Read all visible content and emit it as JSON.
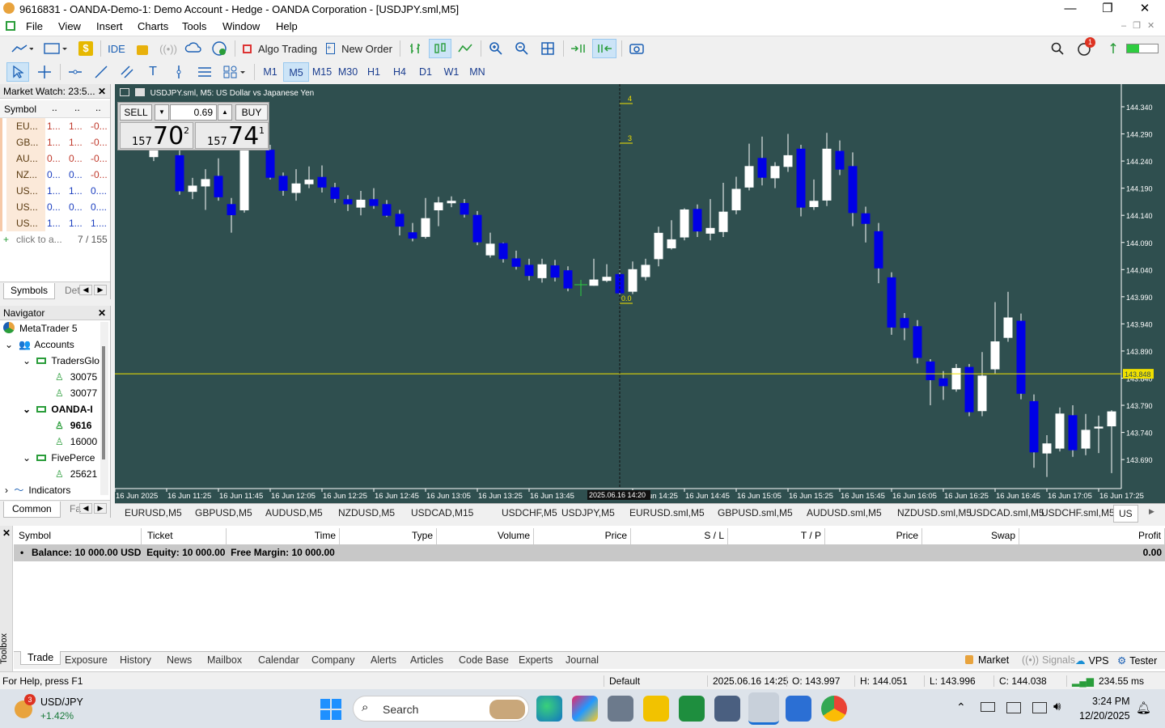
{
  "window": {
    "title": "9616831 - OANDA-Demo-1: Demo Account - Hedge - OANDA Corporation - [USDJPY.sml,M5]"
  },
  "menu": [
    "File",
    "View",
    "Insert",
    "Charts",
    "Tools",
    "Window",
    "Help"
  ],
  "toolbar": {
    "ide": "IDE",
    "algo": "Algo Trading",
    "new_order": "New Order",
    "timeframes": [
      "M1",
      "M5",
      "M15",
      "M30",
      "H1",
      "H4",
      "D1",
      "W1",
      "MN"
    ],
    "active_tf": "M5",
    "alert_count": "1"
  },
  "market_watch": {
    "title": "Market Watch: 23:5...",
    "header": "Symbol",
    "rows": [
      {
        "sym": "EU...",
        "bid": "1...",
        "ask": "1...",
        "chg": "-0..."
      },
      {
        "sym": "GB...",
        "bid": "1...",
        "ask": "1...",
        "chg": "-0..."
      },
      {
        "sym": "AU...",
        "bid": "0...",
        "ask": "0...",
        "chg": "-0..."
      },
      {
        "sym": "NZ...",
        "bid": "0...",
        "ask": "0...",
        "chg": "-0..."
      },
      {
        "sym": "US...",
        "bid": "1...",
        "ask": "1...",
        "chg": "0...."
      },
      {
        "sym": "US...",
        "bid": "0...",
        "ask": "0...",
        "chg": "0...."
      },
      {
        "sym": "US...",
        "bid": "1...",
        "ask": "1...",
        "chg": "1...."
      }
    ],
    "add": "click to a...",
    "count": "7 / 155",
    "tabs": [
      "Symbols",
      "Det"
    ]
  },
  "navigator": {
    "title": "Navigator",
    "items": [
      "MetaTrader 5",
      "Accounts",
      "TradersGlo",
      "30075",
      "30077",
      "OANDA-I",
      "9616",
      "16000",
      "FivePerce",
      "25621",
      "Indicators"
    ],
    "tabs": [
      "Common",
      "Fa"
    ]
  },
  "chart": {
    "label": "USDJPY.sml, M5:  US Dollar vs Japanese Yen",
    "sell": "SELL",
    "buy": "BUY",
    "lot": "0.69",
    "sell_big": "157",
    "sell_main": "70",
    "sell_sup": "2",
    "buy_big": "157",
    "buy_main": "74",
    "buy_sup": "1",
    "price_levels": [
      "144.340",
      "144.290",
      "144.240",
      "144.190",
      "144.140",
      "144.090",
      "144.040",
      "143.990",
      "143.940",
      "143.890",
      "143.840",
      "143.790",
      "143.740",
      "143.690"
    ],
    "current_price": "143.848",
    "time_labels": [
      "16 Jun 2025",
      "16 Jun 11:25",
      "16 Jun 11:45",
      "16 Jun 12:05",
      "16 Jun 12:25",
      "16 Jun 12:45",
      "16 Jun 13:05",
      "16 Jun 13:25",
      "16 Jun 13:45",
      "16 Jun 14:25",
      "16 Jun 14:45",
      "16 Jun 15:05",
      "16 Jun 15:25",
      "16 Jun 15:45",
      "16 Jun 16:05",
      "16 Jun 16:25",
      "16 Jun 16:45",
      "16 Jun 17:05",
      "16 Jun 17:25"
    ],
    "crosshair_time": "2025.06.16 14:20",
    "marker_4": "4",
    "marker_3": "3",
    "marker_0": "0.0"
  },
  "chart_tabs": [
    "EURUSD,M5",
    "GBPUSD,M5",
    "AUDUSD,M5",
    "NZDUSD,M5",
    "USDCAD,M15",
    "USDCHF,M5",
    "USDJPY,M5",
    "EURUSD.sml,M5",
    "GBPUSD.sml,M5",
    "AUDUSD.sml,M5",
    "NZDUSD.sml,M5",
    "USDCAD.sml,M5",
    "USDCHF.sml,M5",
    "US"
  ],
  "trade": {
    "columns": [
      "Symbol",
      "Ticket",
      "Time",
      "Type",
      "Volume",
      "Price",
      "S / L",
      "T / P",
      "Price",
      "Swap",
      "Profit"
    ],
    "balance": "Balance: 10 000.00 USD  Equity: 10 000.00  Free Margin: 10 000.00",
    "profit": "0.00"
  },
  "toolbox_label": "Toolbox",
  "bottom_tabs": [
    "Trade",
    "Exposure",
    "History",
    "News",
    "Mailbox",
    "Calendar",
    "Company",
    "Alerts",
    "Articles",
    "Code Base",
    "Experts",
    "Journal"
  ],
  "bottom_right": [
    "Market",
    "Signals",
    "VPS",
    "Tester"
  ],
  "status": {
    "help": "For Help, press F1",
    "profile": "Default",
    "time": "2025.06.16 14:25",
    "o": "O: 143.997",
    "h": "H: 144.051",
    "l": "L: 143.996",
    "c": "C: 144.038",
    "ping": "234.55 ms"
  },
  "taskbar": {
    "ticker": "USD/JPY",
    "change": "+1.42%",
    "badge": "3",
    "search": "Search",
    "time": "3:24 PM",
    "date": "12/20/2025"
  }
}
